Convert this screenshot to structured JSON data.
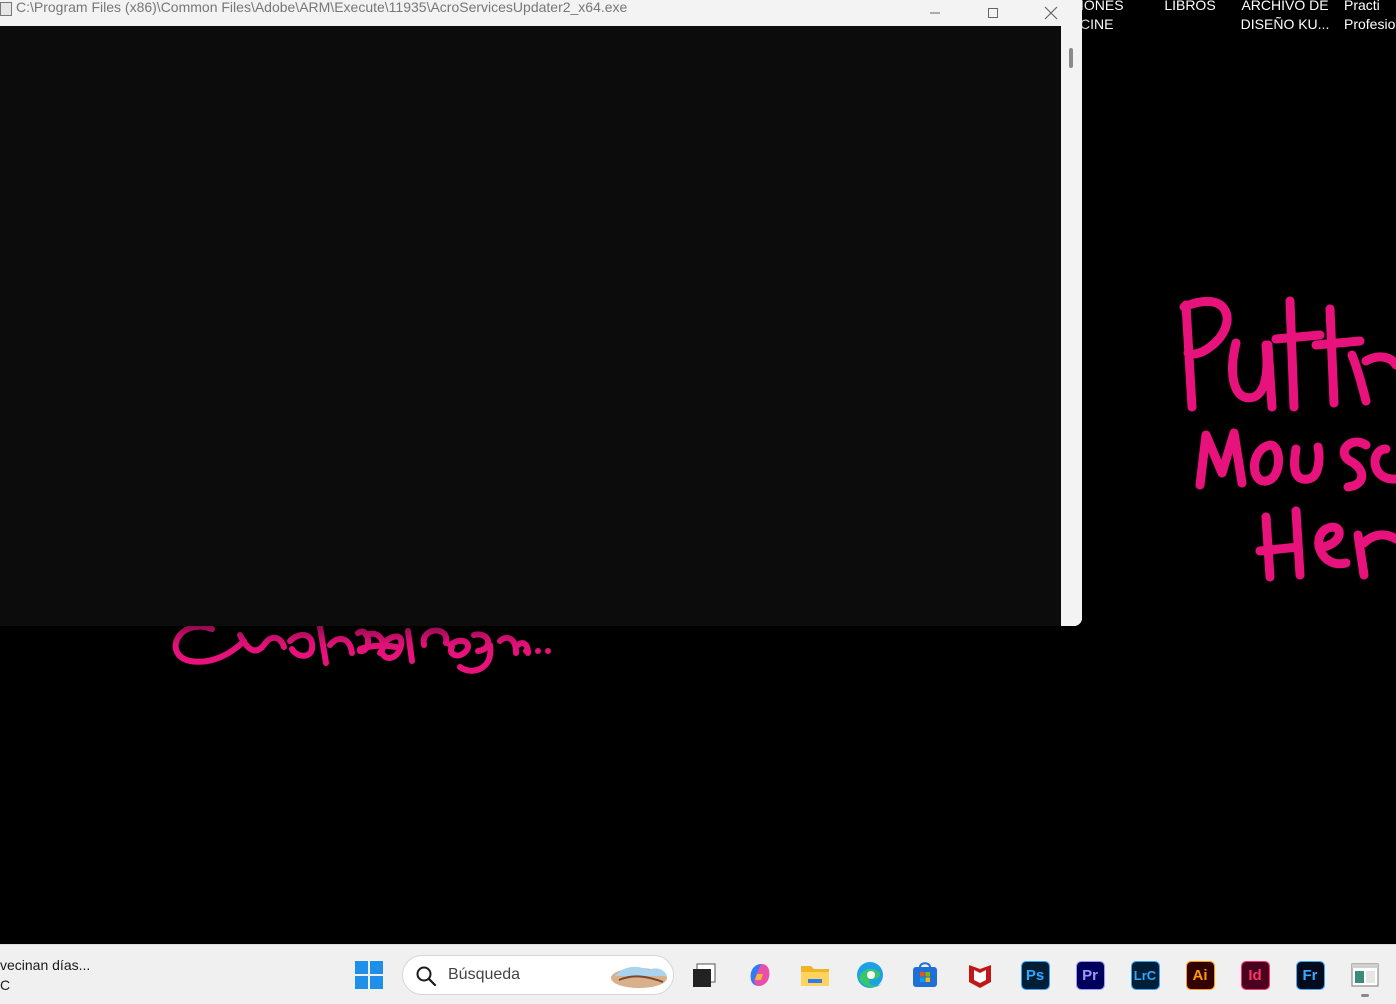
{
  "desktop": {
    "icons": [
      {
        "line1": "IONES",
        "line2": "CINE"
      },
      {
        "line1": "LIBROS",
        "line2": ""
      },
      {
        "line1": "ARCHIVO DE",
        "line2": "DISEÑO KU..."
      },
      {
        "line1": "Practi",
        "line2": "Profesio"
      }
    ],
    "wallpaper": {
      "accent_color": "#e8127c",
      "script_right": [
        "Put th",
        "Mous",
        "Her"
      ],
      "script_bottom": "Graphic Design..."
    }
  },
  "console_window": {
    "title": "C:\\Program Files (x86)\\Common Files\\Adobe\\ARM\\Execute\\11935\\AcroServicesUpdater2_x64.exe",
    "body_color": "#0c0c0c",
    "controls": {
      "minimize": "minimize-icon",
      "maximize": "maximize-icon",
      "close": "close-icon"
    }
  },
  "taskbar": {
    "weather_text": "vecinan días...",
    "weather_sub": "C",
    "search_placeholder": "Búsqueda",
    "pinned": [
      {
        "name": "start",
        "icon": "windows-logo-icon"
      },
      {
        "name": "task-view",
        "icon": "task-view-icon"
      },
      {
        "name": "copilot",
        "icon": "copilot-icon"
      },
      {
        "name": "file-explorer",
        "icon": "folder-icon"
      },
      {
        "name": "edge",
        "icon": "edge-icon"
      },
      {
        "name": "microsoft-store",
        "icon": "store-icon"
      },
      {
        "name": "mcafee",
        "icon": "mcafee-icon"
      },
      {
        "name": "photoshop",
        "label": "Ps",
        "bg": "#001e36",
        "fg": "#31a8ff"
      },
      {
        "name": "premiere",
        "label": "Pr",
        "bg": "#00005b",
        "fg": "#9999ff"
      },
      {
        "name": "lightroom-classic",
        "label": "LrC",
        "bg": "#001e36",
        "fg": "#31a8ff"
      },
      {
        "name": "illustrator",
        "label": "Ai",
        "bg": "#330000",
        "fg": "#ff9a00"
      },
      {
        "name": "indesign",
        "label": "Id",
        "bg": "#49021f",
        "fg": "#ff3366"
      },
      {
        "name": "fresco",
        "label": "Fr",
        "bg": "#000b1d",
        "fg": "#3fa9ff"
      },
      {
        "name": "console-app",
        "icon": "console-window-icon"
      }
    ]
  }
}
